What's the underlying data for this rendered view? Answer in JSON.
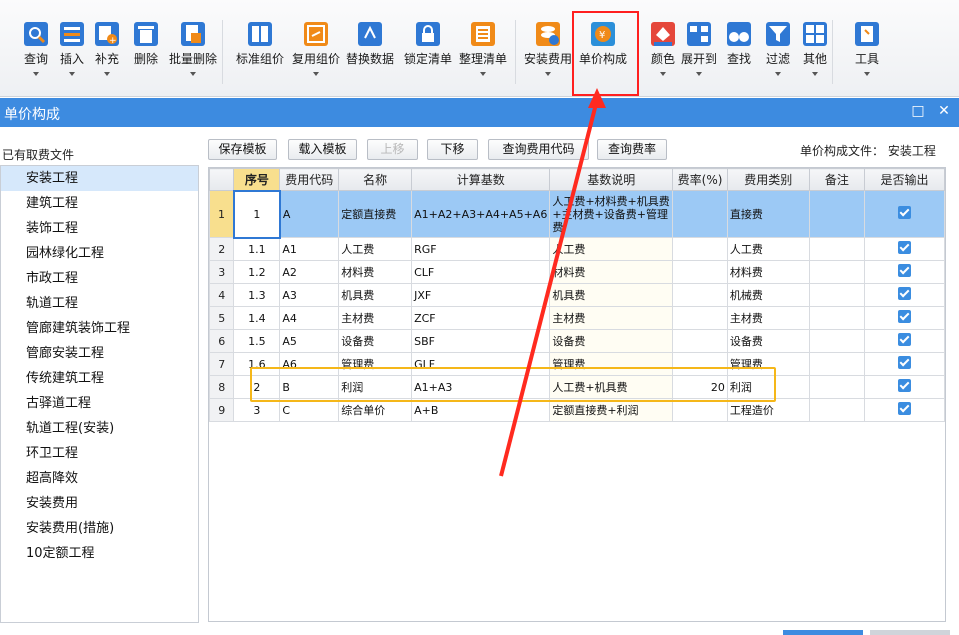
{
  "toolbar": {
    "items": [
      {
        "label": "查询",
        "icon": "search-icon"
      },
      {
        "label": "插入",
        "icon": "insert-icon"
      },
      {
        "label": "补充",
        "icon": "supplement-icon"
      },
      {
        "label": "删除",
        "icon": "trash-icon"
      },
      {
        "label": "批量删除",
        "icon": "batch-delete-icon"
      },
      {
        "label": "标准组价",
        "icon": "standard-price-icon"
      },
      {
        "label": "复用组价",
        "icon": "reuse-price-icon"
      },
      {
        "label": "替换数据",
        "icon": "replace-data-icon"
      },
      {
        "label": "锁定清单",
        "icon": "lock-icon"
      },
      {
        "label": "整理清单",
        "icon": "organize-list-icon"
      },
      {
        "label": "安装费用",
        "icon": "install-fee-icon"
      },
      {
        "label": "单价构成",
        "icon": "unit-price-icon"
      },
      {
        "label": "颜色",
        "icon": "color-icon"
      },
      {
        "label": "展开到",
        "icon": "expand-icon"
      },
      {
        "label": "查找",
        "icon": "binoculars-icon"
      },
      {
        "label": "过滤",
        "icon": "filter-icon"
      },
      {
        "label": "其他",
        "icon": "grid-icon"
      },
      {
        "label": "工具",
        "icon": "wrench-icon"
      }
    ]
  },
  "dialog": {
    "title": "单价构成",
    "left_label": "已有取费文件",
    "file_label": "单价构成文件：",
    "file_value": "安装工程"
  },
  "fee_files": [
    "安装工程",
    "建筑工程",
    "装饰工程",
    "园林绿化工程",
    "市政工程",
    "轨道工程",
    "管廊建筑装饰工程",
    "管廊安装工程",
    "传统建筑工程",
    "古驿道工程",
    "轨道工程(安装)",
    "环卫工程",
    "超高降效",
    "安装费用",
    "安装费用(措施)",
    "10定额工程"
  ],
  "buttons": {
    "save_template": "保存模板",
    "load_template": "载入模板",
    "move_up": "上移",
    "move_down": "下移",
    "query_fee_code": "查询费用代码",
    "query_fee_rate": "查询费率"
  },
  "table": {
    "headers": [
      "序号",
      "费用代码",
      "名称",
      "计算基数",
      "基数说明",
      "费率(%)",
      "费用类别",
      "备注",
      "是否输出"
    ],
    "rows": [
      {
        "rn": "1",
        "seq": "1",
        "code": "A",
        "name": "定额直接费",
        "base": "A1+A2+A3+A4+A5+A6",
        "desc": "人工费+材料费+机具费+主材费+设备费+管理费",
        "rate": "",
        "category": "直接费",
        "note": ""
      },
      {
        "rn": "2",
        "seq": "1.1",
        "code": "A1",
        "name": "人工费",
        "base": "RGF",
        "desc": "人工费",
        "rate": "",
        "category": "人工费",
        "note": ""
      },
      {
        "rn": "3",
        "seq": "1.2",
        "code": "A2",
        "name": "材料费",
        "base": "CLF",
        "desc": "材料费",
        "rate": "",
        "category": "材料费",
        "note": ""
      },
      {
        "rn": "4",
        "seq": "1.3",
        "code": "A3",
        "name": "机具费",
        "base": "JXF",
        "desc": "机具费",
        "rate": "",
        "category": "机械费",
        "note": ""
      },
      {
        "rn": "5",
        "seq": "1.4",
        "code": "A4",
        "name": "主材费",
        "base": "ZCF",
        "desc": "主材费",
        "rate": "",
        "category": "主材费",
        "note": ""
      },
      {
        "rn": "6",
        "seq": "1.5",
        "code": "A5",
        "name": "设备费",
        "base": "SBF",
        "desc": "设备费",
        "rate": "",
        "category": "设备费",
        "note": ""
      },
      {
        "rn": "7",
        "seq": "1.6",
        "code": "A6",
        "name": "管理费",
        "base": "GLF",
        "desc": "管理费",
        "rate": "",
        "category": "管理费",
        "note": ""
      },
      {
        "rn": "8",
        "seq": "2",
        "code": "B",
        "name": "利润",
        "base": "A1+A3",
        "desc": "人工费+机具费",
        "rate": "20",
        "category": "利润",
        "note": ""
      },
      {
        "rn": "9",
        "seq": "3",
        "code": "C",
        "name": "综合单价",
        "base": "A+B",
        "desc": "定额直接费+利润",
        "rate": "",
        "category": "工程造价",
        "note": ""
      }
    ]
  },
  "colors": {
    "titlebar": "#3d8be0",
    "selected_row": "#9cc9f5",
    "annotation_red": "#ff1f1f",
    "annotation_yellow": "#f5b719"
  }
}
